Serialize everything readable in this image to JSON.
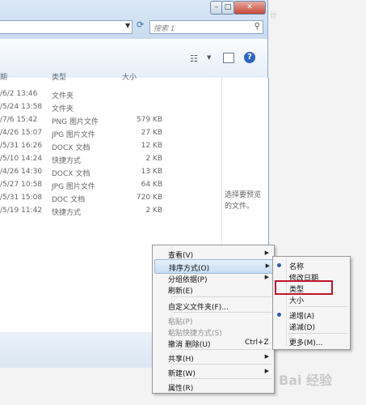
{
  "window": {
    "search_placeholder": "搜索 1",
    "side_text": "计",
    "min_label": "–",
    "max_label": "□",
    "close_label": "✕"
  },
  "columns": {
    "date": "期",
    "type": "类型",
    "size": "大小"
  },
  "files": [
    {
      "date": "/6/2 13:46",
      "type": "文件夹",
      "size": ""
    },
    {
      "date": "/5/24 13:58",
      "type": "文件夹",
      "size": ""
    },
    {
      "date": "/7/6 15:42",
      "type": "PNG 图片文件",
      "size": "579 KB"
    },
    {
      "date": "/4/26 15:07",
      "type": "JPG 图片文件",
      "size": "27 KB"
    },
    {
      "date": "/5/31 16:26",
      "type": "DOCX 文档",
      "size": "12 KB"
    },
    {
      "date": "/5/10 14:24",
      "type": "快捷方式",
      "size": "2 KB"
    },
    {
      "date": "/4/26 14:30",
      "type": "DOCX 文档",
      "size": "13 KB"
    },
    {
      "date": "/5/27 10:58",
      "type": "JPG 图片文件",
      "size": "64 KB"
    },
    {
      "date": "/5/31 15:08",
      "type": "DOC 文档",
      "size": "720 KB"
    },
    {
      "date": "/5/19 11:42",
      "type": "快捷方式",
      "size": "2 KB"
    }
  ],
  "preview": {
    "text": "选择要预览的文件。"
  },
  "context_menu": {
    "items": [
      {
        "label": "查看(V)",
        "shortcut": "",
        "submenu": true,
        "disabled": false
      },
      {
        "label": "排序方式(O)",
        "shortcut": "",
        "submenu": true,
        "disabled": false
      },
      {
        "label": "分组依据(P)",
        "shortcut": "",
        "submenu": true,
        "disabled": false
      },
      {
        "label": "刷新(E)",
        "shortcut": "",
        "submenu": false,
        "disabled": false
      },
      {
        "label": "自定义文件夹(F)...",
        "shortcut": "",
        "submenu": false,
        "disabled": false
      },
      {
        "label": "粘贴(P)",
        "shortcut": "",
        "submenu": false,
        "disabled": true
      },
      {
        "label": "粘贴快捷方式(S)",
        "shortcut": "",
        "submenu": false,
        "disabled": true
      },
      {
        "label": "撤消 删除(U)",
        "shortcut": "Ctrl+Z",
        "submenu": false,
        "disabled": false
      },
      {
        "label": "共享(H)",
        "shortcut": "",
        "submenu": true,
        "disabled": false
      },
      {
        "label": "新建(W)",
        "shortcut": "",
        "submenu": true,
        "disabled": false
      },
      {
        "label": "属性(R)",
        "shortcut": "",
        "submenu": false,
        "disabled": false
      }
    ],
    "submenu_arrow": "▶"
  },
  "sort_submenu": {
    "items": [
      {
        "label": "名称",
        "selected": true
      },
      {
        "label": "修改日期",
        "selected": false
      },
      {
        "label": "类型",
        "selected": false
      },
      {
        "label": "大小",
        "selected": false
      },
      {
        "label": "递增(A)",
        "selected": true
      },
      {
        "label": "递减(D)",
        "selected": false
      },
      {
        "label": "更多(M)...",
        "selected": false
      }
    ]
  },
  "watermark": "Bai 经验"
}
